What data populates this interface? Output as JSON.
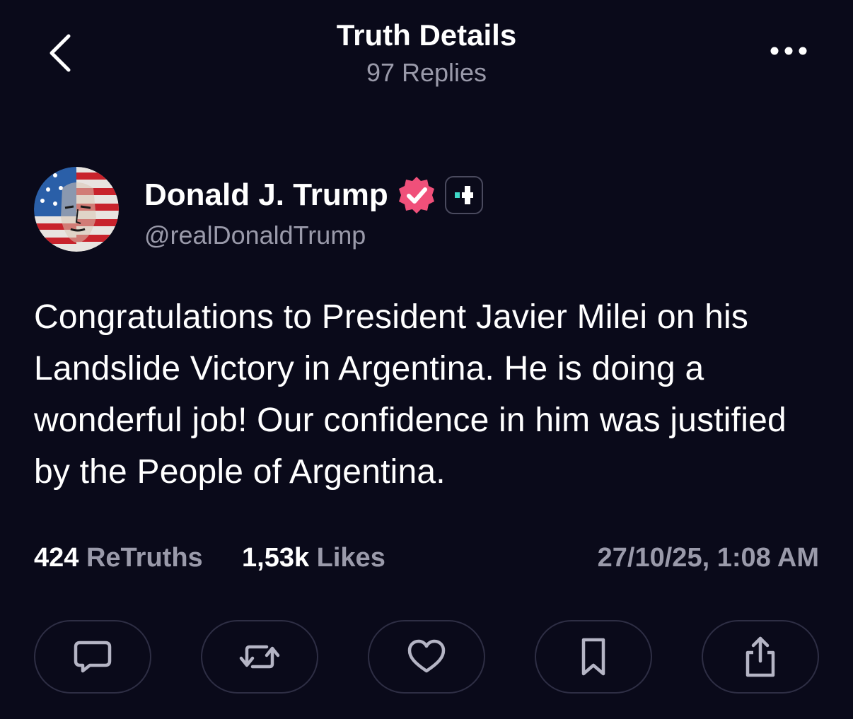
{
  "header": {
    "title": "Truth Details",
    "subtitle": "97 Replies",
    "icons": {
      "back": "chevron-left-icon",
      "more": "more-horizontal-icon"
    }
  },
  "author": {
    "display_name": "Donald J. Trump",
    "handle": "@realDonaldTrump",
    "verified_icon": "verified-badge-icon",
    "plus_icon": "plus-badge-icon",
    "colors": {
      "verified": "#f0507a",
      "plus": "#3fd8c8"
    }
  },
  "post": {
    "text": "Congratulations to President Javier Milei on his Landslide Victory in Argentina. He is doing a wonderful job! Our confidence in him was justified by the People of Argentina."
  },
  "stats": {
    "retruths_count": "424",
    "retruths_label": "ReTruths",
    "likes_count": "1,53k",
    "likes_label": "Likes",
    "timestamp": "27/10/25, 1:08 AM"
  },
  "actions": {
    "icons": [
      "reply-icon",
      "retruth-icon",
      "like-icon",
      "bookmark-icon",
      "share-icon"
    ]
  },
  "colors": {
    "background": "#0a0a1a",
    "primary_text": "#ffffff",
    "secondary_text": "#9a9aaa",
    "button_border": "#2e2e44",
    "icon": "#b5b5c5"
  }
}
